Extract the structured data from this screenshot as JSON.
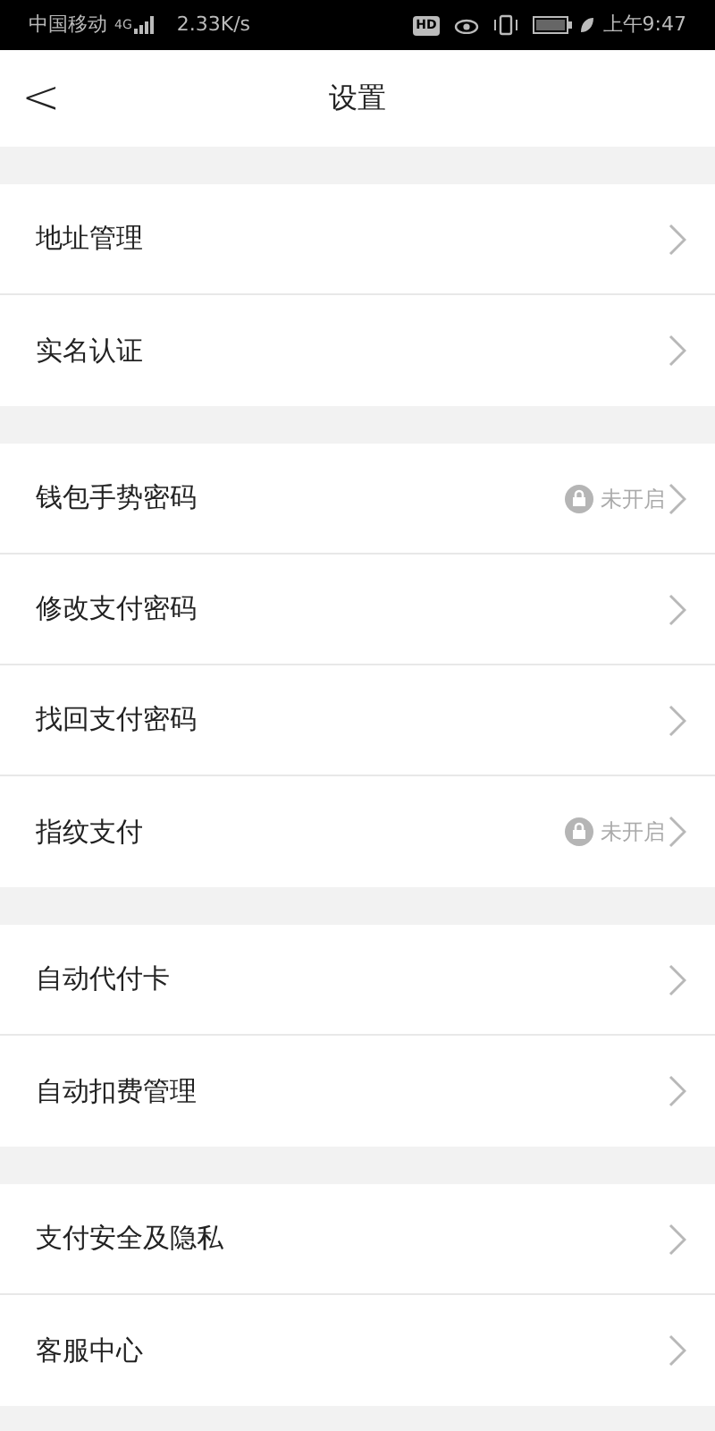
{
  "status_bar": {
    "carrier": "中国移动",
    "network": "4G",
    "speed": "2.33K/s",
    "hd": "HD",
    "time": "上午9:47"
  },
  "header": {
    "back": "<",
    "title": "设置"
  },
  "groups": [
    {
      "items": [
        {
          "label": "地址管理"
        },
        {
          "label": "实名认证"
        }
      ]
    },
    {
      "items": [
        {
          "label": "钱包手势密码",
          "status": "未开启"
        },
        {
          "label": "修改支付密码"
        },
        {
          "label": "找回支付密码"
        },
        {
          "label": "指纹支付",
          "status": "未开启"
        }
      ]
    },
    {
      "items": [
        {
          "label": "自动代付卡"
        },
        {
          "label": "自动扣费管理"
        }
      ]
    },
    {
      "items": [
        {
          "label": "支付安全及隐私"
        },
        {
          "label": "客服中心"
        }
      ]
    }
  ]
}
